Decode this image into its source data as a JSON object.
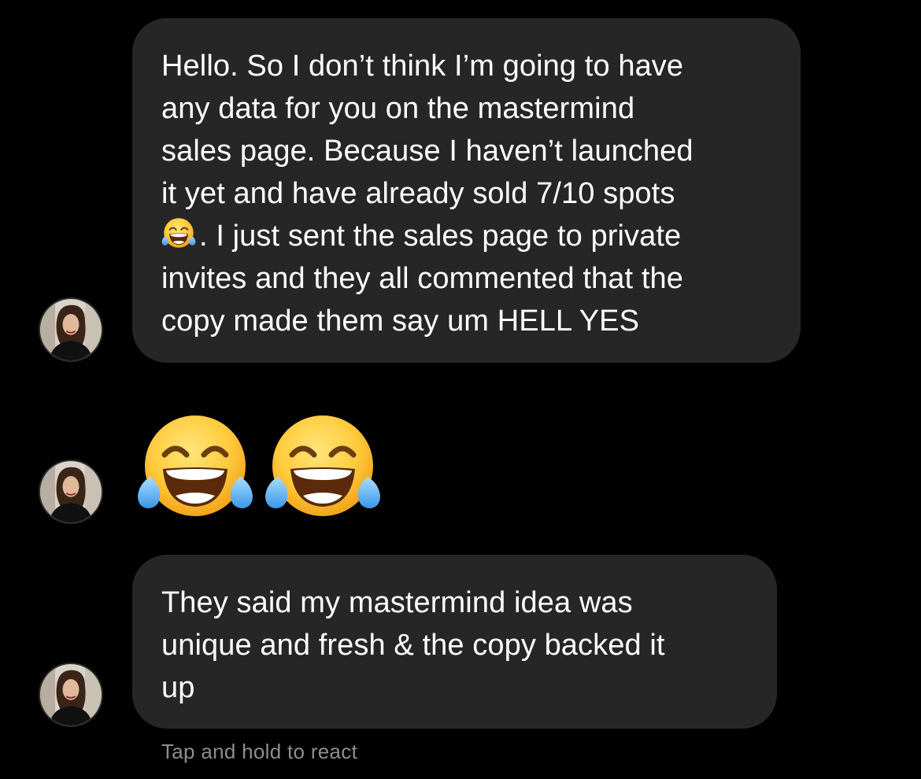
{
  "colors": {
    "background": "#000000",
    "bubble": "#262626",
    "text": "#ffffff",
    "hint_text": "#8e8e8e"
  },
  "messages": [
    {
      "type": "text",
      "lines": [
        "Hello. So I don’t think I’m going to have",
        "any data for you on the mastermind",
        "sales page. Because I haven’t launched",
        "it yet and have already sold 7/10 spots",
        ". I just sent the sales page to private",
        "invites and they all commented that the",
        "copy made them say um HELL YES"
      ],
      "inline_emoji": "face-with-tears-of-joy-icon"
    },
    {
      "type": "emoji",
      "emojis": [
        "face-with-tears-of-joy-icon",
        "face-with-tears-of-joy-icon"
      ]
    },
    {
      "type": "text",
      "lines": [
        "They said my mastermind idea was",
        "unique and fresh & the copy backed it",
        "up"
      ]
    }
  ],
  "footer": {
    "hint": "Tap and hold to react"
  }
}
